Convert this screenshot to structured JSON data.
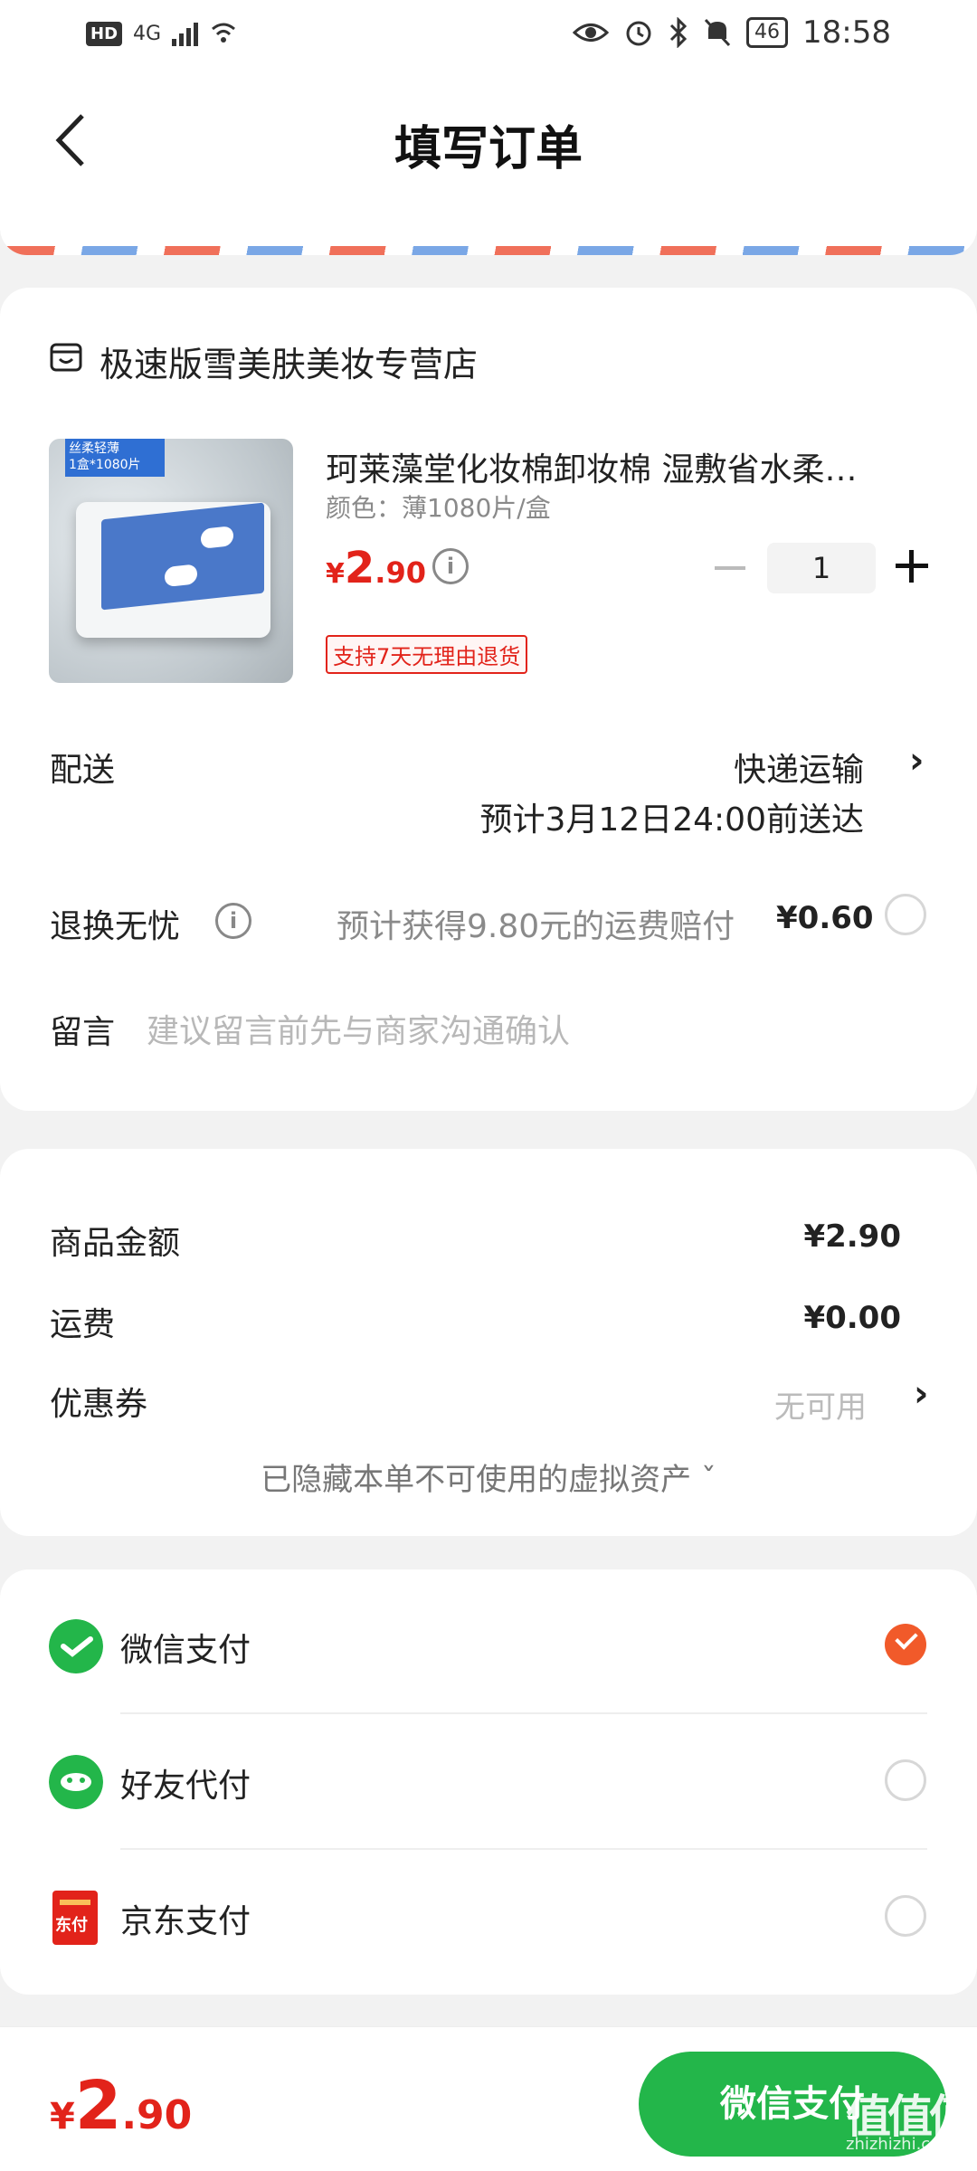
{
  "status_bar": {
    "hd": "HD",
    "network": "4G",
    "battery": "46",
    "time": "18:58",
    "icons": [
      "hd-icon",
      "signal-icon",
      "wifi-icon",
      "eye-icon",
      "alarm-icon",
      "bluetooth-icon",
      "mute-icon",
      "battery-icon"
    ]
  },
  "header": {
    "title": "填写订单"
  },
  "store": {
    "name": "极速版雪美肤美妆专营店",
    "icon": "store-icon"
  },
  "product": {
    "title": "珂莱藻堂化妆棉卸妆棉 湿敷省水柔…",
    "spec": "颜色：薄1080片/盒",
    "price": {
      "currency": "¥",
      "integer": "2",
      "decimal": ".90"
    },
    "quantity": "1",
    "return_tag": "支持7天无理由退货",
    "thumb_tag_line1": "丝柔轻薄",
    "thumb_tag_line2": "1盒*1080片"
  },
  "delivery": {
    "label": "配送",
    "method": "快递运输",
    "eta": "预计3月12日24:00前送达"
  },
  "insurance": {
    "label": "退换无忧",
    "desc": "预计获得9.80元的运费赔付",
    "price": "¥0.60"
  },
  "message": {
    "label": "留言",
    "placeholder": "建议留言前先与商家沟通确认"
  },
  "summary": {
    "goods_label": "商品金额",
    "goods_value": "¥2.90",
    "shipping_label": "运费",
    "shipping_value": "¥0.00",
    "coupon_label": "优惠券",
    "coupon_value": "无可用",
    "hidden_assets": "已隐藏本单不可使用的虚拟资产 ˇ"
  },
  "payment": {
    "methods": [
      {
        "name": "微信支付",
        "icon": "wechat-pay-icon",
        "selected": true
      },
      {
        "name": "好友代付",
        "icon": "friend-pay-icon",
        "selected": false
      },
      {
        "name": "京东支付",
        "icon": "jd-pay-icon",
        "selected": false
      }
    ],
    "jd_icon_text": "东付"
  },
  "footer": {
    "total": {
      "currency": "¥",
      "integer": "2",
      "decimal": ".90"
    },
    "pay_button": "微信支付",
    "watermark": "值值值",
    "watermark_sub": "zhizhizhi.com"
  },
  "colors": {
    "price_red": "#e2231a",
    "wechat_green": "#23b64a",
    "radio_checked": "#f15a2a",
    "stripe_red": "#f0705a",
    "stripe_blue": "#7aa7e6"
  }
}
